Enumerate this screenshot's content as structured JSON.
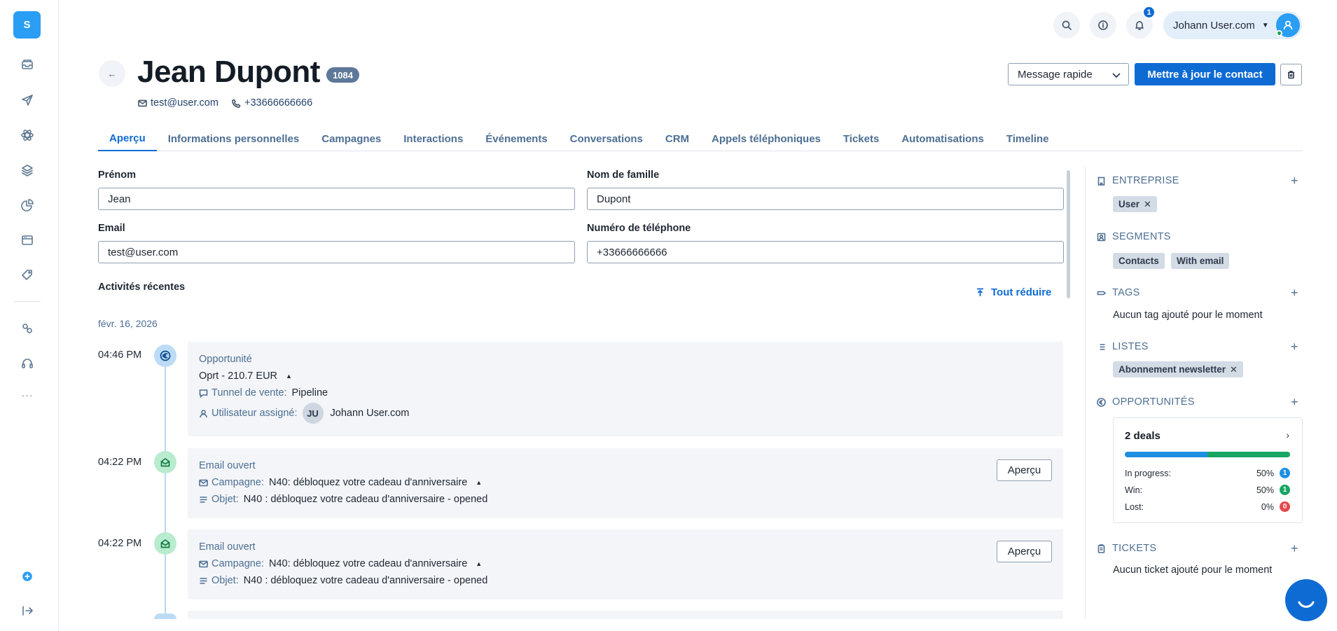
{
  "app": {
    "logo_letter": "S",
    "more_label": "···"
  },
  "topbar": {
    "notification_count": "1",
    "user_name": "Johann User.com"
  },
  "contact": {
    "name": "Jean Dupont",
    "id": "1084",
    "email": "test@user.com",
    "phone": "+33666666666"
  },
  "actions": {
    "quick_message": "Message rapide",
    "update_contact": "Mettre à jour le contact"
  },
  "tabs": [
    {
      "label": "Aperçu",
      "active": true
    },
    {
      "label": "Informations personnelles"
    },
    {
      "label": "Campagnes"
    },
    {
      "label": "Interactions"
    },
    {
      "label": "Événements"
    },
    {
      "label": "Conversations"
    },
    {
      "label": "CRM"
    },
    {
      "label": "Appels téléphoniques"
    },
    {
      "label": "Tickets"
    },
    {
      "label": "Automatisations"
    },
    {
      "label": "Timeline"
    }
  ],
  "form": {
    "first_name_label": "Prénom",
    "first_name_value": "Jean",
    "last_name_label": "Nom de famille",
    "last_name_value": "Dupont",
    "email_label": "Email",
    "email_value": "test@user.com",
    "phone_label": "Numéro de téléphone",
    "phone_value": "+33666666666"
  },
  "activities": {
    "title": "Activités récentes",
    "collapse_label": "Tout réduire",
    "date": "févr. 16, 2026",
    "items": [
      {
        "time": "04:46 PM",
        "type": "Opportunité",
        "headline": "Oprt - 210.7 EUR",
        "pipeline_key": "Tunnel de vente:",
        "pipeline_value": "Pipeline",
        "assignee_key": "Utilisateur assigné:",
        "assignee_initials": "JU",
        "assignee_name": "Johann User.com"
      },
      {
        "time": "04:22 PM",
        "type": "Email ouvert",
        "campaign_key": "Campagne:",
        "campaign_value": "N40: débloquez votre cadeau d'anniversaire",
        "subject_key": "Objet:",
        "subject_value": "N40 : débloquez votre cadeau d'anniversaire - opened",
        "button": "Aperçu"
      },
      {
        "time": "04:22 PM",
        "type": "Email ouvert",
        "campaign_key": "Campagne:",
        "campaign_value": "N40: débloquez votre cadeau d'anniversaire",
        "subject_key": "Objet:",
        "subject_value": "N40 : débloquez votre cadeau d'anniversaire - opened",
        "button": "Aperçu"
      }
    ]
  },
  "sidebar_right": {
    "company": {
      "title": "ENTREPRISE",
      "chips": [
        "User"
      ]
    },
    "segments": {
      "title": "SEGMENTS",
      "chips": [
        "Contacts",
        "With email"
      ]
    },
    "tags": {
      "title": "TAGS",
      "empty": "Aucun tag ajouté pour le moment"
    },
    "lists": {
      "title": "LISTES",
      "chips": [
        "Abonnement newsletter"
      ]
    },
    "opportunities": {
      "title": "OPPORTUNITÉS",
      "deals_label": "2 deals",
      "in_progress_pct": 50,
      "win_pct": 50,
      "rows": [
        {
          "label": "In progress:",
          "pct": "50%",
          "count": "1",
          "color": "#1d8fe3"
        },
        {
          "label": "Win:",
          "pct": "50%",
          "count": "1",
          "color": "#17a664"
        },
        {
          "label": "Lost:",
          "pct": "0%",
          "count": "0",
          "color": "#e5484d"
        }
      ]
    },
    "tickets": {
      "title": "TICKETS",
      "empty": "Aucun ticket ajouté pour le moment"
    }
  },
  "colors": {
    "primary": "#0f6bd4",
    "accent": "#2a9df4",
    "muted_text": "#4d6f93"
  }
}
